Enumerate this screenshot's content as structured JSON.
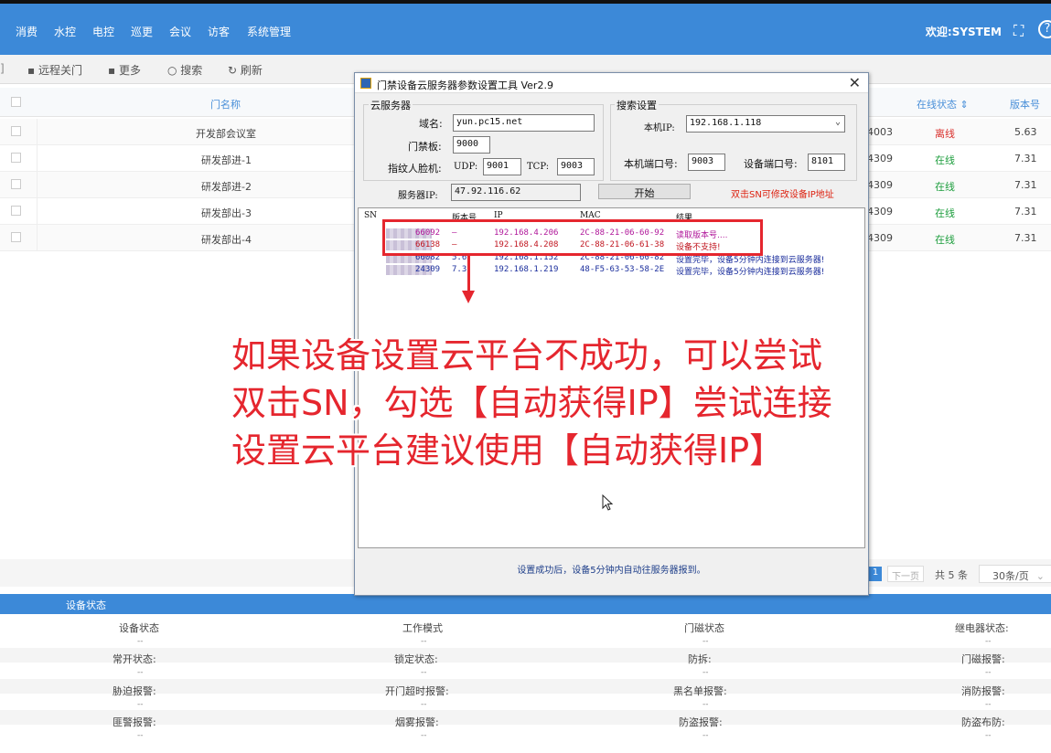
{
  "nav": {
    "items": [
      "消费",
      "水控",
      "电控",
      "巡更",
      "会议",
      "访客",
      "系统管理"
    ],
    "welcome": "欢迎:SYSTEM"
  },
  "toolbar": {
    "items": [
      "远程关门",
      "更多",
      "搜索",
      "刷新"
    ]
  },
  "table": {
    "headers": {
      "name": "门名称",
      "status": "在线状态 ⇕",
      "version": "版本号"
    },
    "rows": [
      {
        "name": "开发部会议室",
        "id_tail": "4003",
        "status": "离线",
        "version": "5.63"
      },
      {
        "name": "研发部进-1",
        "id_tail": "4309",
        "status": "在线",
        "version": "7.31"
      },
      {
        "name": "研发部进-2",
        "id_tail": "4309",
        "status": "在线",
        "version": "7.31"
      },
      {
        "name": "研发部出-3",
        "id_tail": "4309",
        "status": "在线",
        "version": "7.31"
      },
      {
        "name": "研发部出-4",
        "id_tail": "4309",
        "status": "在线",
        "version": "7.31"
      }
    ]
  },
  "pager": {
    "current": "1",
    "next": "下一页",
    "total": "共 5 条",
    "per_page": "30条/页"
  },
  "device_status": {
    "title": "设备状态",
    "rows": [
      [
        "设备状态",
        "工作模式",
        "门磁状态",
        "继电器状态:"
      ],
      [
        "常开状态:",
        "锁定状态:",
        "防拆:",
        "门磁报警:"
      ],
      [
        "胁迫报警:",
        "开门超时报警:",
        "黑名单报警:",
        "消防报警:"
      ],
      [
        "匪警报警:",
        "烟雾报警:",
        "防盗报警:",
        "防盗布防:"
      ]
    ],
    "placeholder": "--"
  },
  "dialog": {
    "title": "门禁设备云服务器参数设置工具 Ver2.9",
    "cloud_group": "云服务器",
    "domain_label": "域名:",
    "domain_value": "yun.pc15.net",
    "door_label": "门禁板:",
    "door_value": "9000",
    "finger_label": "指纹人脸机:",
    "udp_label": "UDP:",
    "udp_value": "9001",
    "tcp_label": "TCP:",
    "tcp_value": "9003",
    "server_ip_label": "服务器IP:",
    "server_ip_value": "47.92.116.62",
    "search_group": "搜索设置",
    "local_ip_label": "本机IP:",
    "local_ip_value": "192.168.1.118",
    "local_port_label": "本机端口号:",
    "local_port_value": "9003",
    "device_port_label": "设备端口号:",
    "device_port_value": "8101",
    "start_button": "开始",
    "hint": "双击SN可修改设备IP地址",
    "list_headers": [
      "SN",
      "版本号",
      "IP",
      "MAC",
      "结果"
    ],
    "list_rows": [
      {
        "sn": "66092",
        "ver": "—",
        "ip": "192.168.4.206",
        "mac": "2C-88-21-06-60-92",
        "result": "读取版本号....",
        "color": "#b0179a"
      },
      {
        "sn": "66138",
        "ver": "—",
        "ip": "192.168.4.208",
        "mac": "2C-88-21-06-61-38",
        "result": "设备不支持!",
        "color": "#c0141e"
      },
      {
        "sn": "66082",
        "ver": "5.6",
        "ip": "192.168.1.152",
        "mac": "2C-88-21-06-60-82",
        "result": "设置完毕，设备5分钟内连接到云服务器!",
        "color": "#1a2d9c"
      },
      {
        "sn": "24309",
        "ver": "7.3",
        "ip": "192.168.1.219",
        "mac": "48-F5-63-53-58-2E",
        "result": "设置完毕，设备5分钟内连接到云服务器!",
        "color": "#1a2d9c"
      }
    ],
    "footer": "设置成功后，设备5分钟内自动往服务器报到。"
  },
  "overlay": {
    "line1": "如果设备设置云平台不成功，可以尝试",
    "line2": "双击SN，勾选【自动获得IP】尝试连接",
    "line3": "设置云平台建议使用【自动获得IP】"
  }
}
